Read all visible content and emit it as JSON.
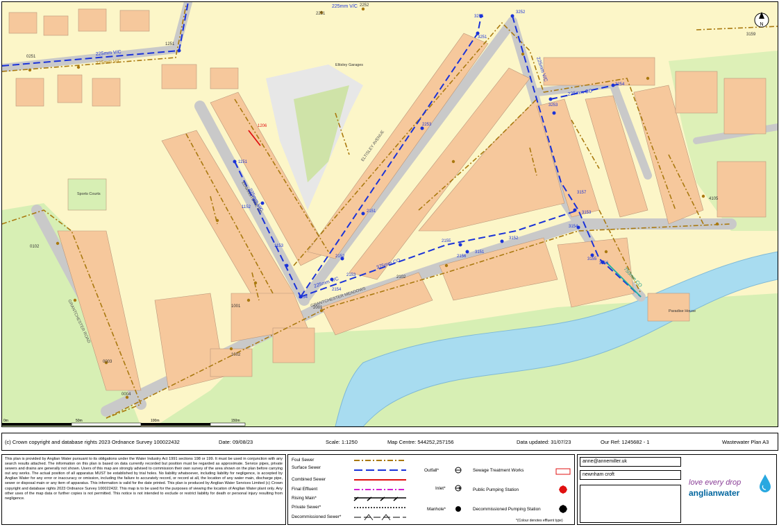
{
  "map": {
    "labels": {
      "sports_courts": "Sports Courts",
      "garages": "Eltisley Garages",
      "paradise_house": "Paradise House",
      "road_1": "EDWINSTOWE RD",
      "road_2": "ELTISLEY AVENUE",
      "road_3": "GRANTCHESTER MEADOWS",
      "road_4": "GRANTCHESTER ROAD"
    },
    "pipe_labels": {
      "p225_topleft": "225mm V/C",
      "p225_topleft2": "225mm V/C",
      "p225_top": "225mm V/C",
      "p225_mid": "225mm V/C",
      "p375": "375mm CO",
      "p225_bottom": "225mm V/C",
      "p225_right": "225mm V/C",
      "p225_cross": "225mm CO",
      "p750": "750mm CO"
    },
    "manholes": {
      "m0251": "0251",
      "m1251": "1251",
      "m2251": "2251",
      "m2252": "2252",
      "m3255": "3255",
      "m3251": "3251",
      "m3252": "3252",
      "m1206": "1206",
      "m2253": "2253",
      "m1151": "1151",
      "m1152": "1152",
      "m1153": "1153",
      "m2151": "2151",
      "m2152": "2152",
      "m2153": "2153",
      "m1154": "1154",
      "m2154": "2154",
      "m2155": "2155",
      "m2156": "2156",
      "m3151": "3151",
      "m3152": "3152",
      "m3153": "3153",
      "m3154": "3154",
      "m3155": "3155",
      "m3156": "3156",
      "m3157": "3157",
      "m3253": "3253",
      "m3254": "3254",
      "m3159": "3159",
      "m4105": "4105",
      "m0102": "0102",
      "m0003": "0003",
      "m0004": "0004",
      "m1001": "1001",
      "m1002": "1002",
      "m2001": "2001",
      "m2102": "2102"
    },
    "north": "N",
    "scale": {
      "s0": "0m",
      "s50": "50m",
      "s100": "100m",
      "s150": "150m"
    }
  },
  "infobar": {
    "copyright": "(c) Crown copyright and database rights 2023 Ordnance Survey 100022432",
    "date": "Date: 09/08/23",
    "scale": "Scale: 1:1250",
    "centre": "Map Centre: 544252,257156",
    "updated": "Data updated: 31/07/23",
    "ref": "Our Ref: 1245682 - 1",
    "plan": "Wastewater Plan A3"
  },
  "notice": "This plan is provided by Anglian Water pursuant to its obligations under the Water Industry Act 1991 sections 198 or 199. It must be used in conjunction with any search results attached. The information on this plan is based on data currently recorded but position must be regarded as approximate. Service pipes, private sewers and drains are generally not shown. Users of this map are strongly advised to commission their own survey of the area shown on the plan before carrying out any works. The actual position of all apparatus MUST be established by trial holes. No liability whatsoever, including liability for negligence, is accepted by Anglian Water for any error or inaccuracy or omission, including the failure to accurately record, or record at all, the location of any water main, discharge pipe, sewer or disposal main or any item of apparatus. This information is valid for the date printed. This plan is produced by Anglian Water Services Limited (c) Crown copyright and database rights 2023 Ordnance Survey 100022432. This map is to be used for the purposes of viewing the location of Anglian Water plant only. Any other uses of the map data or further copies is not permitted. This notice is not intended to exclude or restrict liability for death or personal injury resulting from negligence.",
  "legend": {
    "foul": "Foul Sewer",
    "surface": "Surface Sewer",
    "combined": "Combined Sewer",
    "final": "Final Effluent",
    "rising": "Rising Main*",
    "private": "Private Sewer*",
    "decommissioned": "Decommissioned Sewer*",
    "outfall": "Outfall*",
    "inlet": "Inlet*",
    "manhole": "Manhole*",
    "treatment": "Sewage Treatment Works",
    "pumping": "Public Pumping Station",
    "decom_pumping": "Decommissioned Pumping Station",
    "note": "*(Colour denotes effluent type)"
  },
  "contact": {
    "email": "anne@annemiller.uk",
    "address": "newnham croft"
  },
  "logo": {
    "tagline": "love every drop",
    "brand": "anglianwater"
  },
  "colors": {
    "foul": "#a9790f",
    "surface": "#1a32d8",
    "combined": "#e01010",
    "final": "#d21fd2",
    "land": "#fcf6c8",
    "building": "#f6c89c",
    "road": "#c9c9c9",
    "grass": "#d7efb4",
    "river": "#a8dcf0"
  }
}
